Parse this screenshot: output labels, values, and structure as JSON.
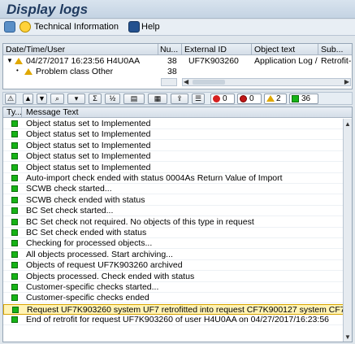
{
  "window": {
    "title": "Display logs"
  },
  "toolbar": {
    "technical_info_label": "Technical Information",
    "help_label": "Help"
  },
  "tree": {
    "columns": [
      "Date/Time/User",
      "Nu...",
      "External ID",
      "Object text",
      "Sub..."
    ],
    "rows": [
      {
        "date_user": "04/27/2017  16:23:56  H4U0AA",
        "number": "38",
        "external_id": "UF7K903260",
        "object_text": "Application Log /...",
        "sub": "Retrofit-"
      },
      {
        "date_user": "Problem class Other",
        "number": "38",
        "external_id": "",
        "object_text": "",
        "sub": ""
      }
    ]
  },
  "counters": {
    "errors": "0",
    "stops": "0",
    "warnings": "2",
    "success": "36"
  },
  "messages": {
    "columns": [
      "Ty...",
      "Message Text"
    ],
    "items": [
      "Object status set to Implemented",
      "Object status set to Implemented",
      "Object status set to Implemented",
      "Object status set to Implemented",
      "Object status set to Implemented",
      "Auto-import check ended with status 0004As Return Value of Import",
      "SCWB check started...",
      "SCWB check ended with status",
      "BC Set check started...",
      "BC Set check not required. No objects of this type in request",
      "BC Set check ended with status",
      "Checking for processed objects...",
      "All objects processed. Start archiving...",
      "Objects of request UF7K903260 archived",
      "Objects processed. Check ended with status",
      "Customer-specific checks started...",
      "Customer-specific checks ended",
      "Request UF7K903260 system UF7 retrofitted into request CF7K900127 system CF7",
      "End of retrofit for request UF7K903260 of user H4U0AA on 04/27/2017/16:23:56"
    ],
    "selected_index": 17
  },
  "colors": {
    "success": "#16b316",
    "warning": "#e0a800",
    "error": "#d52020"
  }
}
